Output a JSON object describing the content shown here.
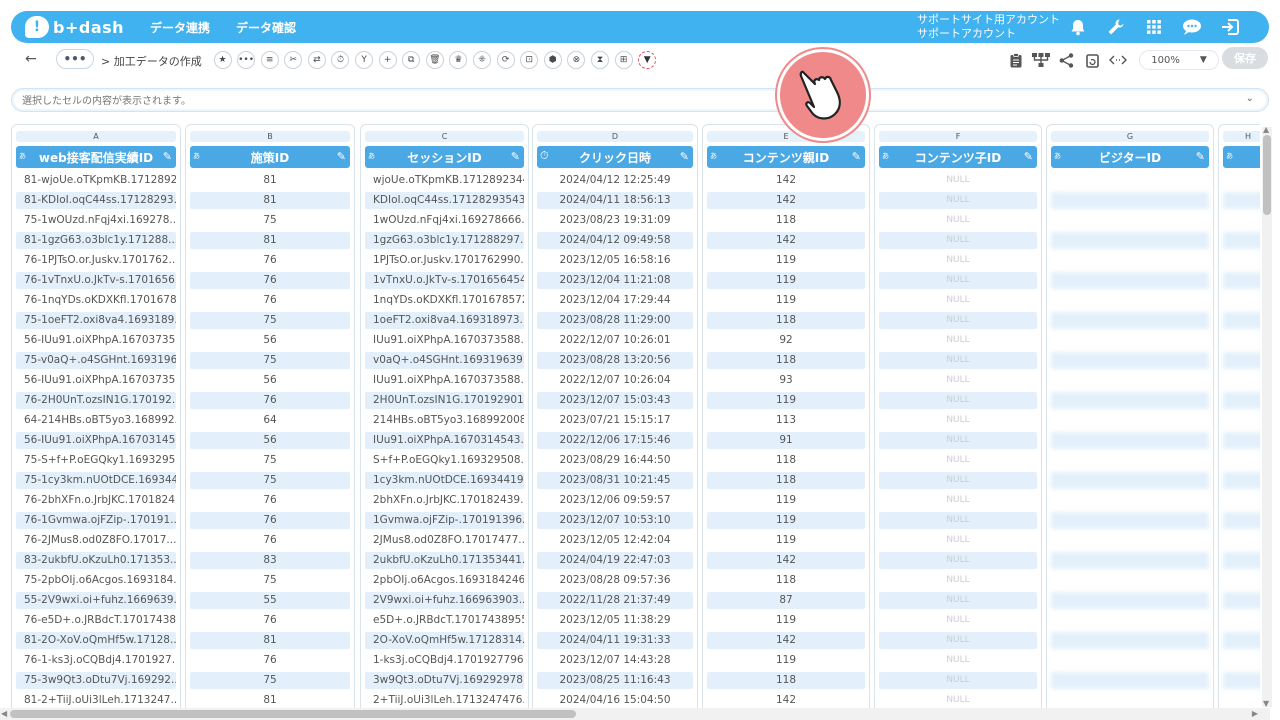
{
  "header": {
    "logo_mark": "!",
    "logo_text": "b+dash",
    "nav": [
      "データ連携",
      "データ確認"
    ],
    "account_line1": "サポートサイト用アカウント",
    "account_line2": "サポートアカウント",
    "icons": [
      "bell-icon",
      "wrench-icon",
      "grid-icon",
      "chat-icon",
      "logout-icon"
    ]
  },
  "toolbar": {
    "back": "←",
    "dots": "•••",
    "breadcrumb": "> 加工データの作成",
    "tools": [
      "★",
      "•••",
      "≡",
      "✂",
      "⇄",
      "⏱",
      "Y",
      "+",
      "⧉",
      "🗑",
      "♛",
      "⁜",
      "⟳",
      "⊡",
      "⬢",
      "⊗",
      "⧗",
      "⊞",
      "▼"
    ],
    "zoom": "100%",
    "save": "保存"
  },
  "cellbar": {
    "placeholder": "選択したセルの内容が表示されます。"
  },
  "columns": [
    {
      "letter": "A",
      "name": "web接客配信実績ID",
      "type": "あ"
    },
    {
      "letter": "B",
      "name": "施策ID",
      "type": "あ"
    },
    {
      "letter": "C",
      "name": "セッションID",
      "type": "あ"
    },
    {
      "letter": "D",
      "name": "クリック日時",
      "type": "⏱"
    },
    {
      "letter": "E",
      "name": "コンテンツ親ID",
      "type": "あ"
    },
    {
      "letter": "F",
      "name": "コンテンツ子ID",
      "type": "あ"
    },
    {
      "letter": "G",
      "name": "ビジターID",
      "type": "あ"
    },
    {
      "letter": "H",
      "name": "",
      "type": "あ"
    }
  ],
  "rows": [
    [
      "81-wjoUe.oTKpmKB.1712892...",
      "81",
      "wjoUe.oTKpmKB.1712892344...",
      "2024/04/12 12:25:49",
      "142",
      "NULL"
    ],
    [
      "81-KDIoI.oqC44ss.17128293...",
      "81",
      "KDIoI.oqC44ss.17128293543...",
      "2024/04/11 18:56:13",
      "142",
      "NULL"
    ],
    [
      "75-1wOUzd.nFqj4xi.169278...",
      "75",
      "1wOUzd.nFqj4xi.169278666...",
      "2023/08/23 19:31:09",
      "118",
      "NULL"
    ],
    [
      "81-1gzG63.o3blc1y.171288...",
      "81",
      "1gzG63.o3blc1y.171288297...",
      "2024/04/12 09:49:58",
      "142",
      "NULL"
    ],
    [
      "76-1PJTsO.or.Juskv.1701762...",
      "76",
      "1PJTsO.or.Juskv.1701762990...",
      "2023/12/05 16:58:16",
      "119",
      "NULL"
    ],
    [
      "76-1vTnxU.o.JkTv-s.1701656...",
      "76",
      "1vTnxU.o.JkTv-s.1701656454...",
      "2023/12/04 11:21:08",
      "119",
      "NULL"
    ],
    [
      "76-1nqYDs.oKDXKfl.1701678...",
      "76",
      "1nqYDs.oKDXKfl.1701678572...",
      "2023/12/04 17:29:44",
      "119",
      "NULL"
    ],
    [
      "75-1oeFT2.oxi8va4.1693189...",
      "75",
      "1oeFT2.oxi8va4.169318973...",
      "2023/08/28 11:29:00",
      "118",
      "NULL"
    ],
    [
      "56-IUu91.oiXPhpA.16703735...",
      "56",
      "IUu91.oiXPhpA.1670373588...",
      "2022/12/07 10:26:01",
      "92",
      "NULL"
    ],
    [
      "75-v0aQ+.o4SGHnt.1693196...",
      "75",
      "v0aQ+.o4SGHnt.169319639...",
      "2023/08/28 13:20:56",
      "118",
      "NULL"
    ],
    [
      "56-IUu91.oiXPhpA.16703735...",
      "56",
      "IUu91.oiXPhpA.1670373588...",
      "2022/12/07 10:26:04",
      "93",
      "NULL"
    ],
    [
      "76-2H0UnT.ozsIN1G.170192...",
      "76",
      "2H0UnT.ozsIN1G.170192901...",
      "2023/12/07 15:03:43",
      "119",
      "NULL"
    ],
    [
      "64-214HBs.oBT5yo3.168992...",
      "64",
      "214HBs.oBT5yo3.168992008...",
      "2023/07/21 15:15:17",
      "113",
      "NULL"
    ],
    [
      "56-IUu91.oiXPhpA.16703145...",
      "56",
      "IUu91.oiXPhpA.1670314543...",
      "2022/12/06 17:15:46",
      "91",
      "NULL"
    ],
    [
      "75-S+f+P.oEGQky1.1693295...",
      "75",
      "S+f+P.oEGQky1.169329508...",
      "2023/08/29 16:44:50",
      "118",
      "NULL"
    ],
    [
      "75-1cy3km.nUOtDCE.169344...",
      "75",
      "1cy3km.nUOtDCE.16934419...",
      "2023/08/31 10:21:45",
      "118",
      "NULL"
    ],
    [
      "76-2bhXFn.o.JrbJKC.1701824...",
      "76",
      "2bhXFn.o.JrbJKC.170182439...",
      "2023/12/06 09:59:57",
      "119",
      "NULL"
    ],
    [
      "76-1Gvmwa.ojFZip-.170191...",
      "76",
      "1Gvmwa.ojFZip-.170191396...",
      "2023/12/07 10:53:10",
      "119",
      "NULL"
    ],
    [
      "76-2JMus8.od0Z8FO.17017...",
      "76",
      "2JMus8.od0Z8FO.17017477...",
      "2023/12/05 12:42:04",
      "119",
      "NULL"
    ],
    [
      "83-2ukbfU.oKzuLh0.171353...",
      "83",
      "2ukbfU.oKzuLh0.171353441...",
      "2024/04/19 22:47:03",
      "142",
      "NULL"
    ],
    [
      "75-2pbOIj.o6Acgos.1693184...",
      "75",
      "2pbOIj.o6Acgos.1693184246...",
      "2023/08/28 09:57:36",
      "118",
      "NULL"
    ],
    [
      "55-2V9wxi.oi+fuhz.1669639...",
      "55",
      "2V9wxi.oi+fuhz.166963903...",
      "2022/11/28 21:37:49",
      "87",
      "NULL"
    ],
    [
      "76-e5D+.o.JRBdcT.17017438...",
      "76",
      "e5D+.o.JRBdcT.17017438955...",
      "2023/12/05 11:38:29",
      "119",
      "NULL"
    ],
    [
      "81-2O-XoV.oQmHf5w.17128...",
      "81",
      "2O-XoV.oQmHf5w.17128314...",
      "2024/04/11 19:31:33",
      "142",
      "NULL"
    ],
    [
      "76-1-ks3j.oCQBdj4.1701927...",
      "76",
      "1-ks3j.oCQBdj4.1701927796...",
      "2023/12/07 14:43:28",
      "119",
      "NULL"
    ],
    [
      "75-3w9Qt3.oDtu7Vj.169292...",
      "75",
      "3w9Qt3.oDtu7Vj.169292978...",
      "2023/08/25 11:16:43",
      "118",
      "NULL"
    ],
    [
      "81-2+TiiJ.oUi3lLeh.1713247...",
      "81",
      "2+TiiJ.oUi3lLeh.1713247476...",
      "2024/04/16 15:04:50",
      "142",
      "NULL"
    ]
  ]
}
